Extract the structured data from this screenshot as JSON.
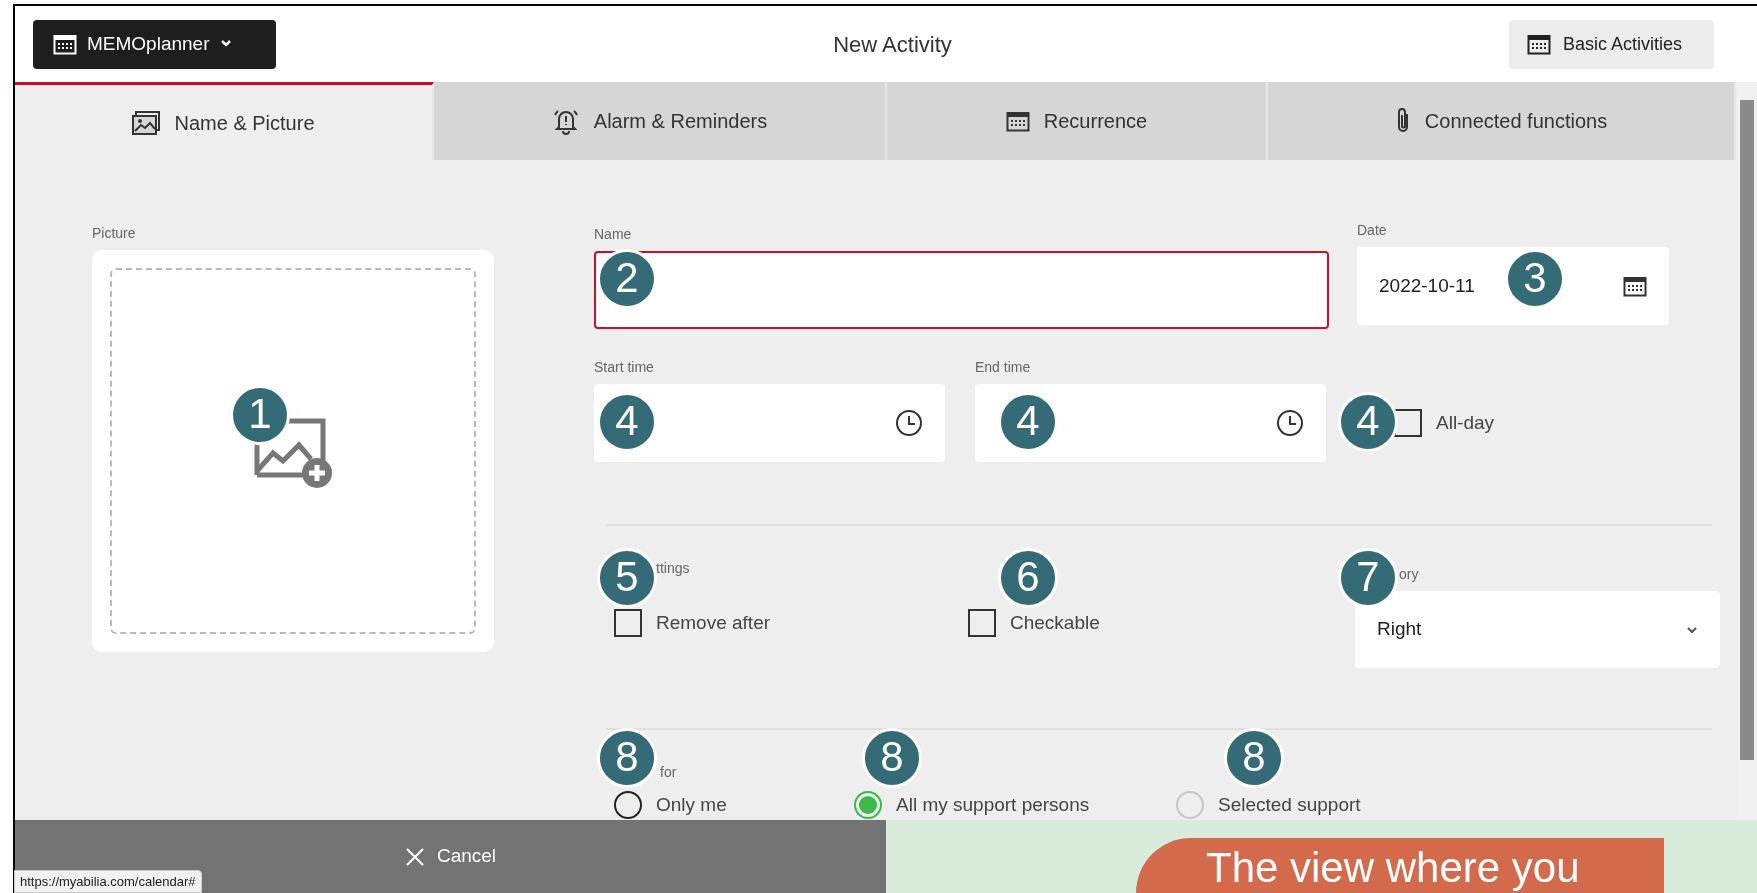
{
  "app_button": {
    "label": "MEMOplanner"
  },
  "window": {
    "title": "New Activity"
  },
  "header_button": {
    "label": "Basic Activities"
  },
  "tabs": [
    {
      "label": "Name & Picture",
      "selected": true,
      "kind": "picture"
    },
    {
      "label": "Alarm & Reminders",
      "selected": false,
      "kind": "alarm"
    },
    {
      "label": "Recurrence",
      "selected": false,
      "kind": "calendar"
    },
    {
      "label": "Connected functions",
      "selected": false,
      "kind": "attachment"
    }
  ],
  "picture": {
    "label": "Picture"
  },
  "name_field": {
    "label": "Name",
    "invalid": true
  },
  "date_field": {
    "label": "Date",
    "value": "2022-10-11"
  },
  "start_time": {
    "label": "Start time"
  },
  "end_time": {
    "label": "End time"
  },
  "all_day": {
    "label": "All-day",
    "checked": false
  },
  "settings": {
    "label": "ttings",
    "options": [
      {
        "label": "Remove after",
        "checked": false
      },
      {
        "label": "Checkable",
        "checked": false
      }
    ]
  },
  "category": {
    "label": "ory",
    "value": "Right"
  },
  "visibility": {
    "label": "for",
    "options": [
      {
        "label": "Only me",
        "selected": false,
        "disabled": false
      },
      {
        "label": "All my support persons",
        "selected": true,
        "disabled": false
      },
      {
        "label": "Selected support",
        "selected": false,
        "disabled": true
      }
    ]
  },
  "cancel_button": {
    "label": "Cancel"
  },
  "status_url": "https://myabilia.com/calendar#",
  "banner": {
    "text": "The view where you"
  },
  "markers": [
    {
      "number": "1"
    },
    {
      "number": "2"
    },
    {
      "number": "3"
    },
    {
      "number": "4"
    },
    {
      "number": "4"
    },
    {
      "number": "4"
    },
    {
      "number": "5"
    },
    {
      "number": "6"
    },
    {
      "number": "7"
    },
    {
      "number": "8"
    },
    {
      "number": "8"
    },
    {
      "number": "8"
    }
  ]
}
